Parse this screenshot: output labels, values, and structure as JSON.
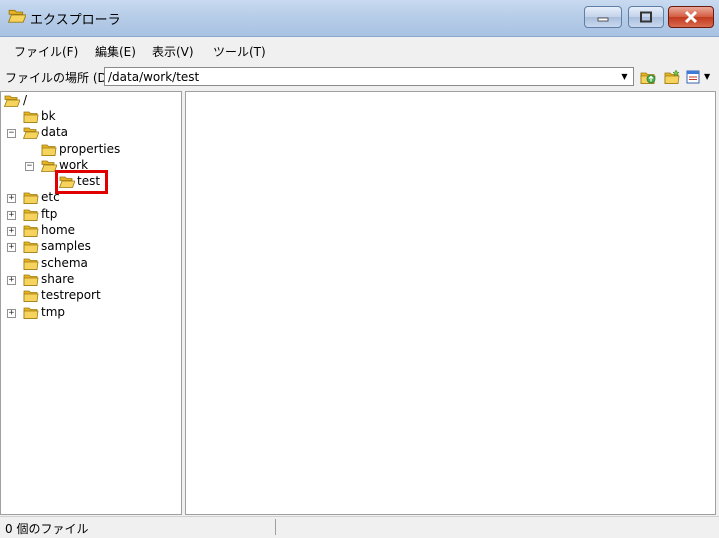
{
  "window": {
    "title": "エクスプローラ"
  },
  "menu": [
    {
      "label": "ファイル(F)"
    },
    {
      "label": "編集(E)"
    },
    {
      "label": "表示(V)"
    },
    {
      "label": "ツール(T)"
    }
  ],
  "address": {
    "label": "ファイルの場所 (D)",
    "value": "/data/work/test"
  },
  "tree": {
    "root": "/",
    "items": [
      {
        "label": "bk"
      },
      {
        "label": "data"
      },
      {
        "label": "properties"
      },
      {
        "label": "work"
      },
      {
        "label": "test"
      },
      {
        "label": "etc"
      },
      {
        "label": "ftp"
      },
      {
        "label": "home"
      },
      {
        "label": "samples"
      },
      {
        "label": "schema"
      },
      {
        "label": "share"
      },
      {
        "label": "testreport"
      },
      {
        "label": "tmp"
      }
    ]
  },
  "status": {
    "text": "0 個のファイル"
  },
  "colors": {
    "highlight": "#e00000",
    "folder": "#f1c232"
  }
}
